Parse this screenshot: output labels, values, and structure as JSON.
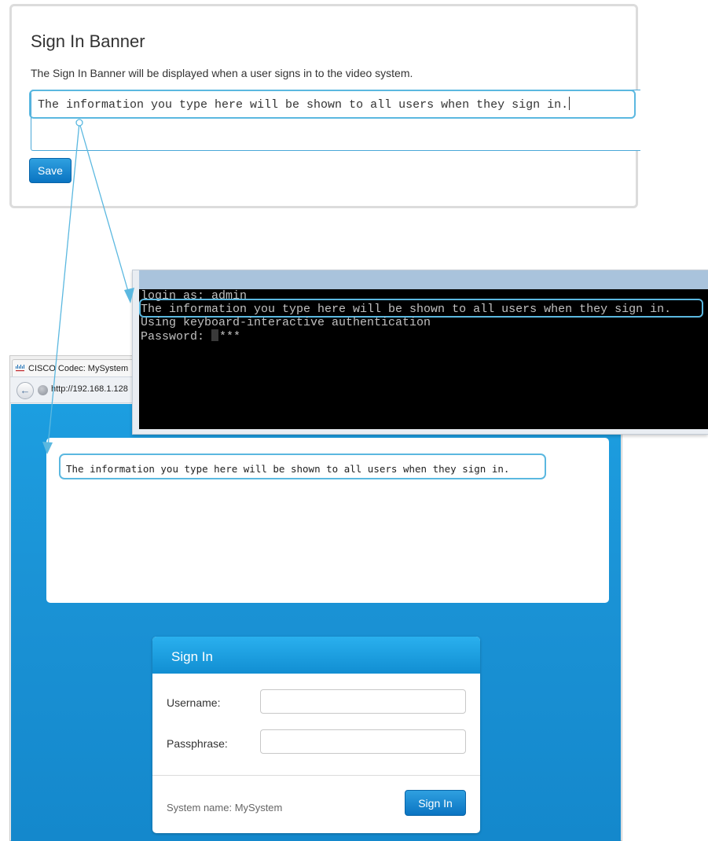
{
  "admin_panel": {
    "title": "Sign In Banner",
    "description": "The Sign In Banner will be displayed when a user signs in to the video system.",
    "banner_text": "The information you type here will be shown to all users when they sign in.",
    "save_label": "Save"
  },
  "ssh_terminal": {
    "lines": [
      "login as: admin",
      "The information you type here will be shown to all users when they sign in.",
      "Using keyboard-interactive authentication",
      "Password: "
    ],
    "password_mask": "***"
  },
  "browser": {
    "tab_title": "CISCO Codec: MySystem",
    "url": "http://192.168.1.128",
    "login_banner_text": "The information you type here will be shown to all users when they sign in.",
    "signin": {
      "title": "Sign In",
      "username_label": "Username:",
      "passphrase_label": "Passphrase:",
      "system_name": "System name: MySystem",
      "button_label": "Sign In"
    }
  },
  "colors": {
    "accent_blue": "#1488cc",
    "highlight_outline": "#5bb8e0",
    "terminal_bg": "#000000"
  },
  "icons": [
    "cisco-logo-icon",
    "back-arrow-icon",
    "globe-icon"
  ]
}
